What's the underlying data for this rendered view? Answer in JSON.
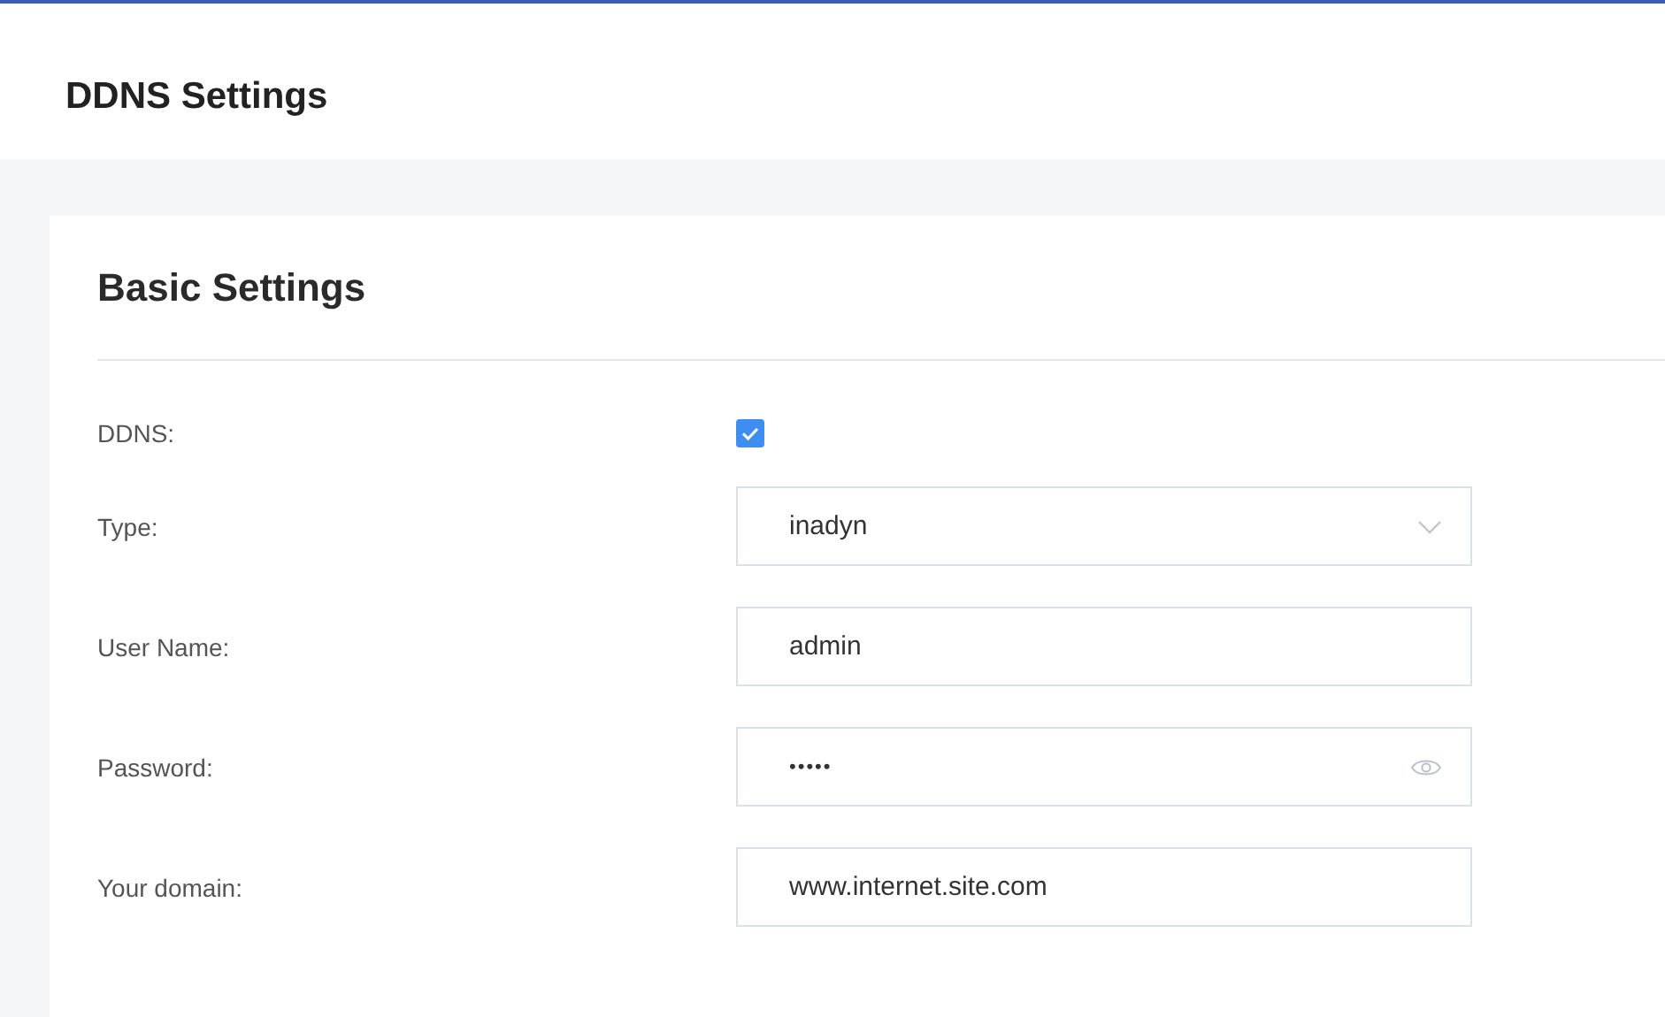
{
  "page_title": "DDNS Settings",
  "section_title": "Basic Settings",
  "fields": [
    {
      "kind": "checkbox",
      "label": "DDNS:",
      "checked": true
    },
    {
      "kind": "select",
      "label": "Type:",
      "value": "inadyn"
    },
    {
      "kind": "text",
      "label": "User Name:",
      "value": "admin"
    },
    {
      "kind": "password",
      "label": "Password:",
      "value": "•••••"
    },
    {
      "kind": "text",
      "label": "Your domain:",
      "value": "www.internet.site.com"
    }
  ]
}
